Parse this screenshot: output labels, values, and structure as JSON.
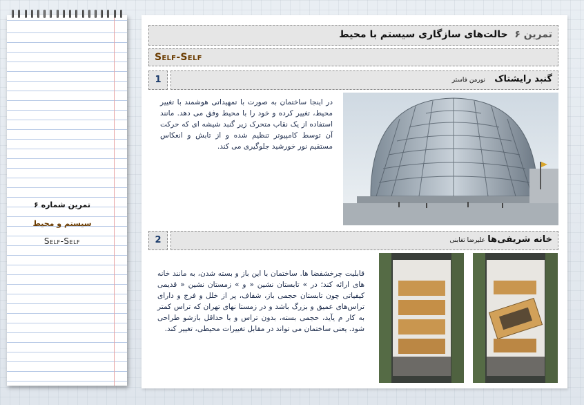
{
  "notebook": {
    "line1": "تمرین شماره ۶",
    "line2": "سیستم و محیط",
    "line3": "Self-Self"
  },
  "header": {
    "title_num": "تمرین ۶",
    "title_text": "حالت‌های سازگاری سیستم با محیط",
    "subtitle": "Self-Self"
  },
  "cases": [
    {
      "number": "1",
      "name": "گنبد رایشتاک",
      "architect": "نورمن فاستر",
      "description": "در اینجا ساختمان به صورت با تمهیداتی هوشمند با تغییر محیط، تغییر کرده و خود را با محیط وفق می دهد. مانند استفاده از یک نقاب متحرک زیر گنبد شیشه ای که حرکت آن توسط کامپیوتر تنظیم شده و از تابش و انعکاس مستقیم نور خورشید جلوگیری می کند."
    },
    {
      "number": "2",
      "name": "خانه شریفی‌ها",
      "architect": "علیرضا تغابنی",
      "description": "قابلیت چرخشفضا ها. ساختمان با این باز و بسته شدن، به مانند خانه های ارائه کند؛ در » تابستان نشین « و » زمستان نشین « قدیمی کیفیاتی چون تابستان حجمی باز، شفاف، پر از خلل و فرج و دارای تراس‌های عمیق و بزرگ باشد و در زمستا نهای تهران که تراس کمتر به کار م یآید، حجمی بسته، بدون تراس و با حداقل بازشو طراحی شود. یعنی ساختمان می تواند در مقابل تغییرات محیطی، تغییر کند."
    }
  ]
}
